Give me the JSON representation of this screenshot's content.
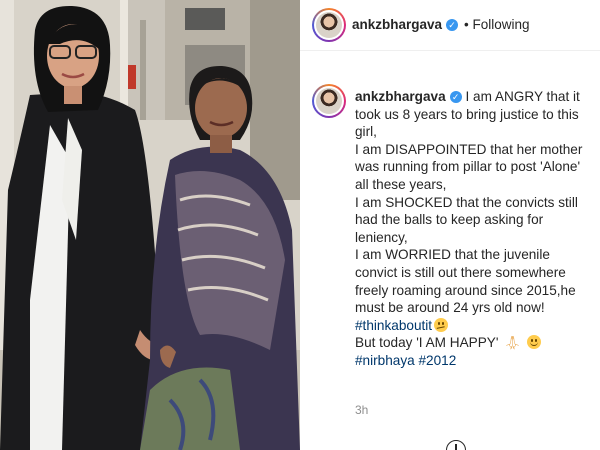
{
  "post": {
    "username": "ankzbhargava",
    "follow_status": "Following",
    "verified_mark": "✓",
    "caption": {
      "lines": [
        "I am ANGRY that it",
        "took us 8 years to bring justice to this",
        "girl,",
        "I am DISAPPOINTED that her mother",
        "was running from pillar to post 'Alone'",
        "all these years,",
        "I am SHOCKED that the convicts still",
        "had the balls to keep asking for",
        "leniency,",
        "I am WORRIED that the juvenile",
        "convict is still out there somewhere",
        "freely roaming around since 2015,he",
        "must be around 24 yrs old now!"
      ],
      "hashtag_think": "#thinkaboutit",
      "happy_line": "But today 'I AM HAPPY' ",
      "hashtag_nirbhaya": "#nirbhaya",
      "hashtag_2012": "#2012"
    },
    "timestamp": "3h"
  },
  "icons": {
    "verified": "verified-badge-icon",
    "thinking": "thinking-face-emoji",
    "pray": "folded-hands-emoji",
    "smile": "smiling-face-emoji",
    "add": "add-circle-icon"
  },
  "colors": {
    "link": "#00376b",
    "verified": "#3897f0",
    "muted": "#8e8e8e"
  }
}
